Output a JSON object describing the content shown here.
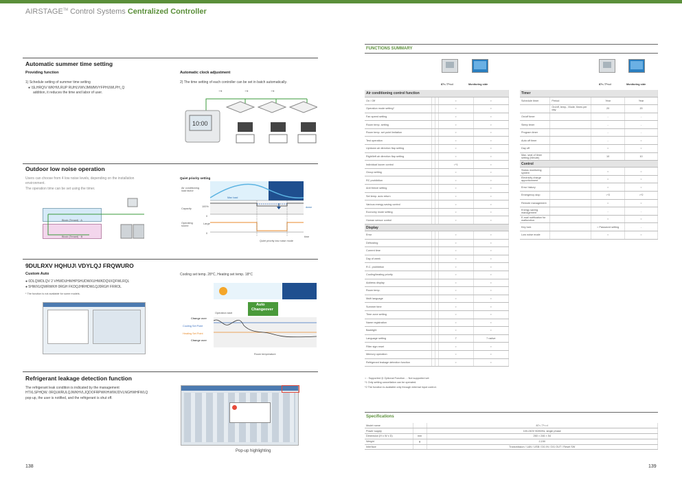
{
  "header": {
    "brand_prefix": "AIRSTAGE",
    "brand_tm": "TM",
    "brand_mid": " Control Systems ",
    "brand_green": "Centralized Controller"
  },
  "left": {
    "s1": {
      "title": "Automatic summer time setting",
      "sub1": "Providing function",
      "t1": "1) Schedule setting of summer time setting",
      "t2": "● \\SLHRQ\\V WKHVLRUP RUHLVWVJMWMVYFPHUWLPH_Q",
      "t3": "addition, it reduces the time and labor of user.",
      "sub2": "Automatic clock adjustment",
      "t4": "2) The time setting of each controller can be set in batch automatically.",
      "clock": "10:00"
    },
    "s2": {
      "title": "Outdoor low noise  operation",
      "t1": "Users can choose from 4 low noise levels, depending on the installation",
      "t2": "environment.",
      "t3": "The operation time can be set using the timer.",
      "block_a": "Block (Tenant) · A",
      "block_b": "Block (Tenant) · B",
      "chart_title": "Quiet priority setting",
      "y1": "Air conditioning load factor",
      "y2": "Capacity",
      "y3": "Operating sound",
      "v100": "100%",
      "v0a": "0",
      "vlarge": "Large",
      "v0b": "0",
      "max_load": "Max load",
      "down": "down",
      "time": "time",
      "period": "Quiet priority low noise mode"
    },
    "s3": {
      "title": "9DULRXV HQHUJ\\ VDYLQJ FRQWURO",
      "sub": "Custom Auto",
      "t1": "● 0DLQWDLQV 2 VHWDUHWHPSHUDWXUHWKDQ\\IXQFWLRQL",
      "t2": "● 5HWXUQWRWKH 0RGH FKDQJHRHDWLQJ0RGH FRROL",
      "note": "* The function is not available  for some models.",
      "caption": "Cooling  set  temp. 28°C, Heating set temp. 18°C",
      "op_start": "Operation start",
      "auto": "Auto",
      "changeover": "Changeover",
      "change_over1": "Change over",
      "cooling_sp": "Cooling Set Point",
      "heating_sp": "Heating Set Point",
      "change_over2": "Change over",
      "room_temp": "Room temperature"
    },
    "s4": {
      "title": "Refrigerant leakage detection  function",
      "t1": "The refrigerant leak condition is indicated by the management",
      "t2": "HTXLSPHQW. 0RQLWRULQJWKHVLJQDOFRPWKH\\WWJDVLNGHWHFWLQ",
      "t3": "pop-up, the user is notified, and the refrigerant is shut off.",
      "popup": "Pop-up highlighting"
    },
    "page": "138"
  },
  "right": {
    "func_title": "FUNCTIONS SUMMARY",
    "col1": "87<-'7*<=I",
    "col2": "Monitoring  side",
    "cats_left": [
      {
        "name": "Air conditioning control function",
        "rows": [
          [
            "On / Off",
            "",
            "",
            "○",
            "○"
          ],
          [
            "Operation  mode setting*",
            "",
            "",
            "○",
            "○"
          ],
          [
            "Fan speed  setting",
            "",
            "",
            "○",
            "○"
          ],
          [
            "Room temp.  setting",
            "",
            "",
            "○",
            "○"
          ],
          [
            "Room temp.  set  point limitation",
            "",
            "",
            "○",
            "○"
          ],
          [
            "Test operation",
            "",
            "",
            "○",
            "○"
          ],
          [
            "Up/down air direction  flap setting",
            "",
            "",
            "○",
            "○"
          ],
          [
            "Right/left  air direction  flap setting",
            "",
            "",
            "○",
            "○"
          ],
          [
            "Individual  louver control",
            "",
            "",
            "○*1",
            "○"
          ],
          [
            "Group setting",
            "",
            "",
            "○",
            "○"
          ],
          [
            "RC prohibition",
            "",
            "",
            "○",
            "○"
          ],
          [
            "Anti freeze  setting",
            "",
            "",
            "○",
            "○"
          ],
          [
            "Set temp.  auto return",
            "",
            "",
            "○",
            "○"
          ],
          [
            "Various energy  saving  control",
            "",
            "",
            "○",
            "○"
          ],
          [
            "Economy  mode setting",
            "",
            "",
            "○",
            "○"
          ],
          [
            "Human  sensor  control",
            "",
            "",
            "○",
            "○"
          ]
        ]
      },
      {
        "name": "Display",
        "rows": [
          [
            "Error",
            "",
            "",
            "○",
            "○"
          ],
          [
            "Defrosting",
            "",
            "",
            "○",
            "○"
          ],
          [
            "Current time",
            "",
            "",
            "○",
            "○"
          ],
          [
            "Day  of week",
            "",
            "",
            "○",
            "○"
          ],
          [
            "R.C. prohibition",
            "",
            "",
            "○",
            "○"
          ],
          [
            "Cooling/heating  priority",
            "",
            "",
            "○",
            "○"
          ],
          [
            "Address display",
            "",
            "",
            "○",
            "○"
          ],
          [
            "Room temp.",
            "",
            "",
            "○",
            "○"
          ],
          [
            "Multi language",
            "",
            "",
            "○",
            "○"
          ],
          [
            "Summer  time",
            "",
            "",
            "○",
            "○"
          ],
          [
            "Time zone setting",
            "",
            "",
            "○",
            "○"
          ],
          [
            "Name  registration",
            "",
            "",
            "○",
            "○"
          ],
          [
            "Backlight",
            "",
            "",
            "○",
            "○"
          ],
          [
            "Language   setting",
            "",
            "",
            "7",
            "7 native"
          ],
          [
            "Filter sign reset",
            "",
            "",
            "○",
            "○"
          ],
          [
            "Memory  operation",
            "",
            "",
            "○",
            "○"
          ],
          [
            "Refrigerant  leakage  detection  function",
            "",
            "",
            "○",
            "○"
          ]
        ]
      }
    ],
    "cats_right": [
      {
        "name": "Timer",
        "rows": [
          [
            "Schedule  timer",
            "Period",
            "Year",
            "Year"
          ],
          [
            "",
            "On/off, temp., Mode, times per day",
            "20",
            "20"
          ],
          [
            "On/off timer",
            "",
            "-",
            "-"
          ],
          [
            "Sleep  timer",
            "",
            "-",
            "-"
          ],
          [
            "Program  timer",
            "",
            "-",
            "-"
          ],
          [
            "Auto off timer",
            "",
            "-",
            "○"
          ],
          [
            "Day  off",
            "",
            "○",
            "○"
          ],
          [
            "Max. seat of timer setting (Minute)",
            "",
            "10",
            "10"
          ]
        ]
      },
      {
        "name": "Control",
        "rows": [
          [
            "Status  monitoring  system",
            "",
            "○",
            "○"
          ],
          [
            "Electricity  charge apportionment",
            "",
            "○",
            "○"
          ],
          [
            "Error history",
            "",
            "○",
            "○"
          ],
          [
            "Emergency  stop",
            "",
            "○*2",
            "○*2"
          ],
          [
            "Remote  management",
            "",
            "○",
            "○"
          ],
          [
            "Energy  saving  management",
            "",
            "-",
            "-"
          ],
          [
            "E-mail  notification  for malfunction",
            "",
            "○",
            "○"
          ],
          [
            "Key lock",
            "",
            "○ Password setting",
            "-"
          ],
          [
            "Low noise  mode",
            "",
            "○",
            "○"
          ]
        ]
      }
    ],
    "foot1": "○ : Supported    ◎ Optional Function -   : Not supported set",
    "foot2": "*1  Only setting  cancellation  can be operated.",
    "foot3": "*2  The function is available  only through external input control.",
    "spec_title": "Specifications",
    "specs": [
      [
        "Model name",
        "",
        "87<-'7*<=I"
      ],
      [
        "Power supply",
        "",
        "100-240V 50/60Hz, single phase"
      ],
      [
        "Dimension  (H x W x D)",
        "mm",
        "260 × 246 × 54"
      ],
      [
        "Weight",
        "g",
        "2,150"
      ],
      [
        "Interface",
        "",
        "Transmission / LAN / USB / DI1 IN / DI1 OUT / Reset SW"
      ]
    ],
    "page": "139"
  }
}
